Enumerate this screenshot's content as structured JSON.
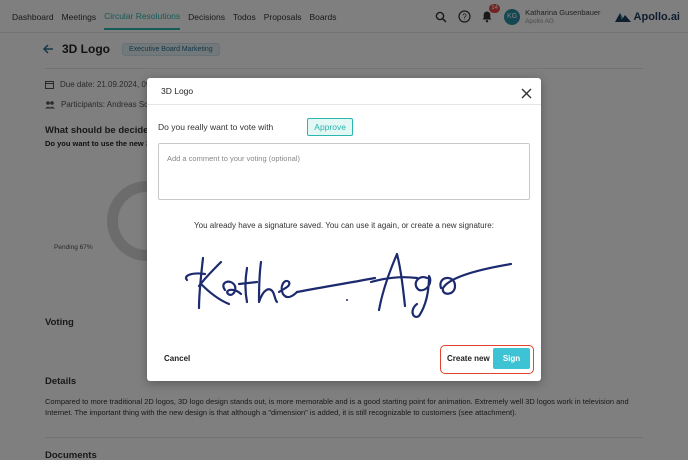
{
  "nav": {
    "items": [
      {
        "label": "Dashboard",
        "active": false
      },
      {
        "label": "Meetings",
        "active": false
      },
      {
        "label": "Circular Resolutions",
        "active": true
      },
      {
        "label": "Decisions",
        "active": false
      },
      {
        "label": "Todos",
        "active": false
      },
      {
        "label": "Proposals",
        "active": false
      },
      {
        "label": "Boards",
        "active": false
      }
    ],
    "notification_count": "14",
    "user_initials": "KG",
    "user_name": "Katharina Gusenbauer",
    "user_company": "Apollo AG",
    "brand": "Apollo.ai",
    "accent_color": "#2bb6b1"
  },
  "page": {
    "title": "3D Logo",
    "tag": "Executive Board Marketing",
    "due_date": "Due date: 21.09.2024, 09:",
    "participants": "Participants: Andreas Sch",
    "question_heading": "What should be decide",
    "question_text": "Do you want to use the new 3",
    "pending_label": "Pending 67%",
    "voting_heading": "Voting",
    "details_heading": "Details",
    "details_text": "Compared to more traditional 2D logos, 3D logo design stands out, is more memorable and is a good starting point for animation. Extremely well 3D logos work in television and Internet. The important thing with the new design is that although a \"dimension\" is added, it is still recognizable to customers (see attachment).",
    "documents_heading": "Documents"
  },
  "modal": {
    "title": "3D Logo",
    "vote_prompt": "Do you really want to vote with",
    "vote_choice": "Approve",
    "comment_placeholder": "Add a comment to your voting (optional)",
    "signature_text": "You already have a signature saved. You can use it again, or create a new signature:",
    "cancel_label": "Cancel",
    "create_new_label": "Create new",
    "sign_label": "Sign",
    "sign_color": "#3ec3d4",
    "highlight_color": "#e0442c"
  }
}
